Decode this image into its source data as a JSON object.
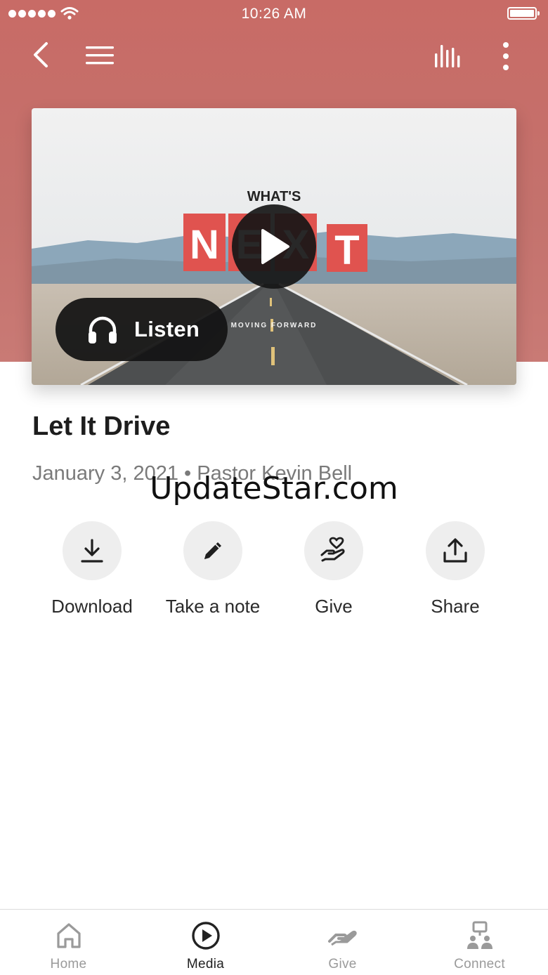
{
  "status_bar": {
    "time": "10:26 AM"
  },
  "colors": {
    "header": "#c86b66",
    "chip": "#eeeeee",
    "active_tab": "#222222",
    "inactive_tab": "#9a9a9a"
  },
  "media": {
    "artwork_text": {
      "line1": "WHAT'S",
      "letters": [
        "N",
        "E",
        "X",
        "T"
      ],
      "tagline": "MOVING FORWARD"
    },
    "listen_label": "Listen",
    "title": "Let It Drive",
    "meta": "January 3, 2021 • Pastor Kevin Bell"
  },
  "watermark": "UpdateStar.com",
  "actions": [
    {
      "label": "Download",
      "icon": "download-icon"
    },
    {
      "label": "Take a note",
      "icon": "pencil-icon"
    },
    {
      "label": "Give",
      "icon": "heart-hand-icon"
    },
    {
      "label": "Share",
      "icon": "share-icon"
    }
  ],
  "tabs": [
    {
      "label": "Home",
      "icon": "home-icon",
      "active": false
    },
    {
      "label": "Media",
      "icon": "play-circle-icon",
      "active": true
    },
    {
      "label": "Give",
      "icon": "give-hand-icon",
      "active": false
    },
    {
      "label": "Connect",
      "icon": "connect-icon",
      "active": false
    }
  ]
}
